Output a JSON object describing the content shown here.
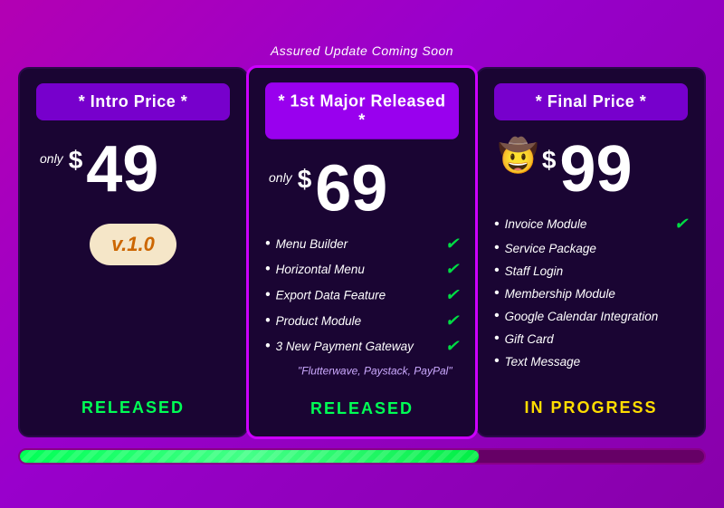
{
  "page": {
    "assured_text": "Assured Update Coming Soon",
    "progress_fill_percent": 67
  },
  "cards": {
    "left": {
      "title": "* Intro Price *",
      "price_only": "only",
      "price_dollar": "$",
      "price_number": "49",
      "version": "v.1.0",
      "status": "RELEASED",
      "status_class": "released"
    },
    "middle": {
      "title": "* 1st Major Released *",
      "price_only": "only",
      "price_dollar": "$",
      "price_number": "69",
      "features": [
        {
          "text": "Menu Builder",
          "checked": true
        },
        {
          "text": "Horizontal Menu",
          "checked": true
        },
        {
          "text": "Export Data Feature",
          "checked": true
        },
        {
          "text": "Product Module",
          "checked": true
        },
        {
          "text": "3 New Payment Gateway",
          "checked": true
        }
      ],
      "sub_note": "\"Flutterwave, Paystack, PayPal\"",
      "status": "RELEASED"
    },
    "right": {
      "title": "* Final Price *",
      "price_emoji": "🤠",
      "price_dollar": "$",
      "price_number": "99",
      "features": [
        {
          "text": "Invoice Module",
          "checked": true
        },
        {
          "text": "Service Package",
          "checked": false
        },
        {
          "text": "Staff Login",
          "checked": false
        },
        {
          "text": "Membership Module",
          "checked": false
        },
        {
          "text": "Google Calendar Integration",
          "checked": false
        },
        {
          "text": "Gift Card",
          "checked": false
        },
        {
          "text": "Text Message",
          "checked": false
        }
      ],
      "status": "IN PROGRESS"
    }
  }
}
